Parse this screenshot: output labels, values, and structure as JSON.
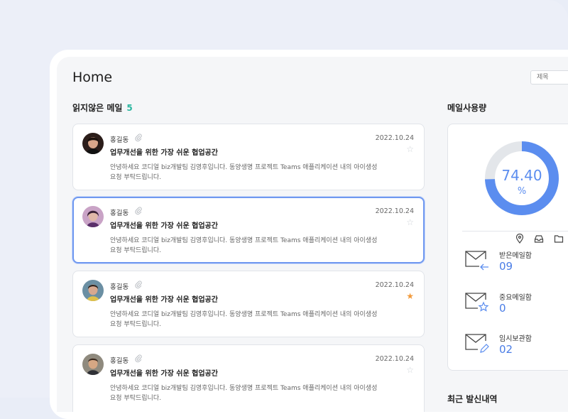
{
  "header": {
    "title": "Home",
    "search_placeholder": "제목"
  },
  "unread": {
    "label": "읽지않은 메일",
    "count": "5",
    "mails": [
      {
        "sender": "홍길동",
        "subject": "업무개선을 위한 가장 쉬운 협업공간",
        "preview": "안녕하세요 코디얼 biz개발팀 김영후입니다. 동양생명 프로젝트 Teams 애플리케이션 내의 아이생성 요청 부탁드립니다.",
        "date": "2022.10.24",
        "starred": false
      },
      {
        "sender": "홍길동",
        "subject": "업무개선을 위한 가장 쉬운 협업공간",
        "preview": "안녕하세요 코디얼 biz개발팀 김영후입니다. 동양생명 프로젝트 Teams 애플리케이션 내의 아이생성 요청 부탁드립니다.",
        "date": "2022.10.24",
        "starred": false
      },
      {
        "sender": "홍길동",
        "subject": "업무개선을 위한 가장 쉬운 협업공간",
        "preview": "안녕하세요 코디얼 biz개발팀 김영후입니다. 동양생명 프로젝트 Teams 애플리케이션 내의 아이생성 요청 부탁드립니다.",
        "date": "2022.10.24",
        "starred": true
      },
      {
        "sender": "홍길동",
        "subject": "업무개선을 위한 가장 쉬운 협업공간",
        "preview": "안녕하세요 코디얼 biz개발팀 김영후입니다. 동양생명 프로젝트 Teams 애플리케이션 내의 아이생성 요청 부탁드립니다.",
        "date": "2022.10.24",
        "starred": false
      }
    ]
  },
  "usage": {
    "label": "메일사용량",
    "percent_text": "74.40",
    "percent_value": 74.4,
    "unit": "%",
    "accent": "#5b8def",
    "boxes": [
      {
        "label": "받은메일함",
        "count": "09",
        "icon": "inbox-arrow-icon"
      },
      {
        "label": "중요메일함",
        "count": "0",
        "icon": "important-star-icon"
      },
      {
        "label": "임시보관함",
        "count": "02",
        "icon": "draft-pencil-icon"
      }
    ],
    "tools": [
      "location-icon",
      "inbox-tray-icon",
      "folder-icon"
    ]
  },
  "sent": {
    "label": "최근 발신내역"
  }
}
